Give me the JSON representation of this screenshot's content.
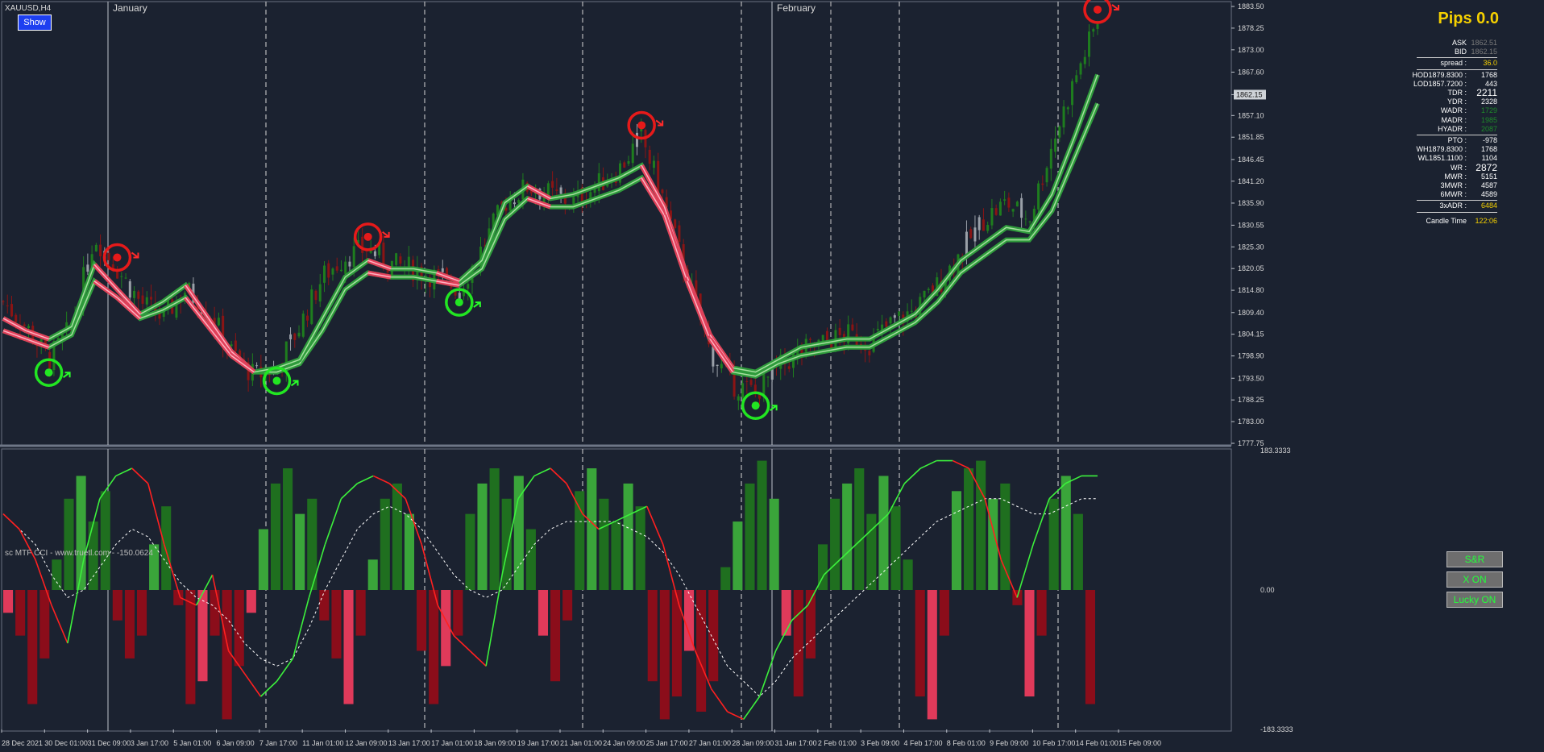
{
  "window": {
    "symbol_label": "XAUUSD,H4",
    "show_button": "Show"
  },
  "info_panel": {
    "pips_title": "Pips 0.0",
    "rows": [
      {
        "label": "ASK",
        "value": "1862.51",
        "value_color": "#7a7a7a"
      },
      {
        "label": "BID",
        "value": "1862.15",
        "value_color": "#7a7a7a"
      },
      {
        "label": "spread :",
        "value": "36.0",
        "value_color": "#f5d000"
      },
      {
        "label": "HOD1879.8300 :",
        "value": "1768",
        "value_color": "#ffffff"
      },
      {
        "label": "LOD1857.7200 :",
        "value": "443",
        "value_color": "#ffffff"
      },
      {
        "label": "TDR :",
        "value": "2211",
        "value_color": "#ffffff"
      },
      {
        "label": "YDR :",
        "value": "2328",
        "value_color": "#ffffff"
      },
      {
        "label": "WADR :",
        "value": "1729",
        "value_color": "#1e8a2a"
      },
      {
        "label": "MADR :",
        "value": "1985",
        "value_color": "#1e8a2a"
      },
      {
        "label": "HYADR :",
        "value": "2087",
        "value_color": "#1e8a2a"
      },
      {
        "label": "PTO :",
        "value": "-978",
        "value_color": "#ffffff"
      },
      {
        "label": "WH1879.8300 :",
        "value": "1768",
        "value_color": "#ffffff"
      },
      {
        "label": "WL1851.1100 :",
        "value": "1104",
        "value_color": "#ffffff"
      },
      {
        "label": "WR :",
        "value": "2872",
        "value_color": "#ffffff"
      },
      {
        "label": "MWR :",
        "value": "5151",
        "value_color": "#ffffff"
      },
      {
        "label": "3MWR :",
        "value": "4587",
        "value_color": "#ffffff"
      },
      {
        "label": "6MWR :",
        "value": "4589",
        "value_color": "#ffffff"
      },
      {
        "label": "3xADR :",
        "value": "6484",
        "value_color": "#f5d000"
      },
      {
        "label": "Candle Time",
        "value": "122:06",
        "value_color": "#f5d000"
      }
    ]
  },
  "indicator": {
    "label": "sc MTF CCI - www.truetl.com - -150.0624",
    "buttons": [
      "S&R",
      "X ON",
      "Lucky ON"
    ]
  },
  "chart_data": [
    {
      "type": "candlestick",
      "title": "XAUUSD,H4",
      "month_labels": [
        "January",
        "February"
      ],
      "y_ticks": [
        "1883.50",
        "1878.25",
        "1873.00",
        "1867.60",
        "1862.15",
        "1857.10",
        "1851.85",
        "1846.45",
        "1841.20",
        "1835.90",
        "1830.55",
        "1825.30",
        "1820.05",
        "1814.80",
        "1809.40",
        "1804.15",
        "1798.90",
        "1793.50",
        "1788.25",
        "1783.00",
        "1777.75"
      ],
      "current_price": "1862.15",
      "ylim": [
        1777.75,
        1883.5
      ],
      "x_ticks": [
        "28 Dec 2021",
        "30 Dec 01:00",
        "31 Dec 09:00",
        "3 Jan 17:00",
        "5 Jan 01:00",
        "6 Jan 09:00",
        "7 Jan 17:00",
        "11 Jan 01:00",
        "12 Jan 09:00",
        "13 Jan 17:00",
        "17 Jan 01:00",
        "18 Jan 09:00",
        "19 Jan 17:00",
        "21 Jan 01:00",
        "24 Jan 09:00",
        "25 Jan 17:00",
        "27 Jan 01:00",
        "28 Jan 09:00",
        "31 Jan 17:00",
        "2 Feb 01:00",
        "3 Feb 09:00",
        "4 Feb 17:00",
        "8 Feb 01:00",
        "9 Feb 09:00",
        "10 Feb 17:00",
        "14 Feb 01:00",
        "15 Feb 09:00"
      ],
      "price_path": [
        1812,
        1806,
        1798,
        1806,
        1828,
        1820,
        1812,
        1808,
        1815,
        1810,
        1800,
        1794,
        1796,
        1806,
        1818,
        1823,
        1825,
        1821,
        1820,
        1818,
        1815,
        1825,
        1836,
        1840,
        1838,
        1836,
        1840,
        1844,
        1852,
        1836,
        1818,
        1800,
        1792,
        1790,
        1796,
        1800,
        1802,
        1804,
        1802,
        1807,
        1810,
        1816,
        1824,
        1832,
        1836,
        1832,
        1850,
        1866,
        1880
      ],
      "fast_ma": [
        1808,
        1805,
        1803,
        1806,
        1821,
        1815,
        1809,
        1812,
        1816,
        1808,
        1800,
        1795,
        1796,
        1798,
        1808,
        1818,
        1822,
        1820,
        1820,
        1819,
        1817,
        1822,
        1836,
        1840,
        1837,
        1838,
        1840,
        1842,
        1845,
        1835,
        1818,
        1804,
        1796,
        1795,
        1798,
        1801,
        1802,
        1803,
        1803,
        1806,
        1809,
        1815,
        1822,
        1826,
        1830,
        1829,
        1838,
        1852,
        1867
      ],
      "slow_ma": [
        1805,
        1803,
        1801,
        1804,
        1817,
        1813,
        1808,
        1810,
        1813,
        1806,
        1799,
        1795,
        1795,
        1797,
        1805,
        1815,
        1819,
        1818,
        1818,
        1817,
        1816,
        1820,
        1832,
        1837,
        1835,
        1835,
        1837,
        1839,
        1842,
        1833,
        1817,
        1803,
        1795,
        1794,
        1797,
        1799,
        1800,
        1801,
        1801,
        1804,
        1807,
        1812,
        1819,
        1823,
        1827,
        1827,
        1834,
        1847,
        1860
      ],
      "sell_signals_at": [
        5,
        16,
        28,
        48
      ],
      "buy_signals_at": [
        2,
        12,
        20,
        33
      ]
    },
    {
      "type": "bar",
      "title": "sc MTF CCI - www.truetl.com - -150.0624",
      "y_ticks": [
        "183.3333",
        "0.00",
        "-183.3333"
      ],
      "ylim": [
        -183.3333,
        183.3333
      ],
      "values": [
        -30,
        -60,
        -150,
        -90,
        40,
        120,
        150,
        90,
        130,
        -40,
        -90,
        -60,
        60,
        110,
        -20,
        -150,
        -120,
        -60,
        -170,
        -100,
        -30,
        80,
        140,
        160,
        100,
        120,
        -40,
        -90,
        -150,
        -60,
        40,
        120,
        140,
        100,
        -80,
        -150,
        -100,
        -60,
        100,
        140,
        160,
        120,
        150,
        80,
        -60,
        -120,
        -40,
        130,
        160,
        120,
        90,
        140,
        110,
        -120,
        -170,
        -140,
        -80,
        -160,
        -120,
        30,
        90,
        140,
        170,
        120,
        -60,
        -140,
        -90,
        60,
        120,
        140,
        160,
        100,
        150,
        110,
        40,
        -140,
        -170,
        -60,
        130,
        160,
        170,
        120,
        140,
        -20,
        -140,
        -60,
        120,
        150,
        100,
        -150
      ],
      "cci_fast": [
        100,
        80,
        40,
        -20,
        -70,
        40,
        120,
        150,
        160,
        140,
        60,
        -10,
        -20,
        20,
        -80,
        -110,
        -140,
        -120,
        -90,
        -10,
        60,
        120,
        140,
        150,
        140,
        120,
        60,
        -20,
        -60,
        -80,
        -100,
        20,
        120,
        150,
        160,
        140,
        100,
        80,
        90,
        100,
        110,
        60,
        -20,
        -80,
        -130,
        -160,
        -170,
        -140,
        -80,
        -40,
        -20,
        20,
        40,
        60,
        80,
        100,
        140,
        160,
        170,
        170,
        160,
        120,
        40,
        -10,
        60,
        120,
        140,
        150,
        150
      ],
      "cci_slow": [
        100,
        80,
        60,
        20,
        -10,
        0,
        30,
        60,
        80,
        70,
        40,
        10,
        -10,
        -20,
        -40,
        -70,
        -90,
        -100,
        -90,
        -50,
        0,
        40,
        80,
        100,
        110,
        100,
        80,
        50,
        20,
        0,
        -10,
        0,
        30,
        60,
        80,
        90,
        90,
        90,
        90,
        80,
        70,
        50,
        20,
        -20,
        -60,
        -100,
        -120,
        -140,
        -120,
        -90,
        -70,
        -50,
        -30,
        -10,
        10,
        30,
        50,
        70,
        90,
        100,
        110,
        120,
        120,
        110,
        100,
        100,
        110,
        120,
        120
      ]
    }
  ]
}
